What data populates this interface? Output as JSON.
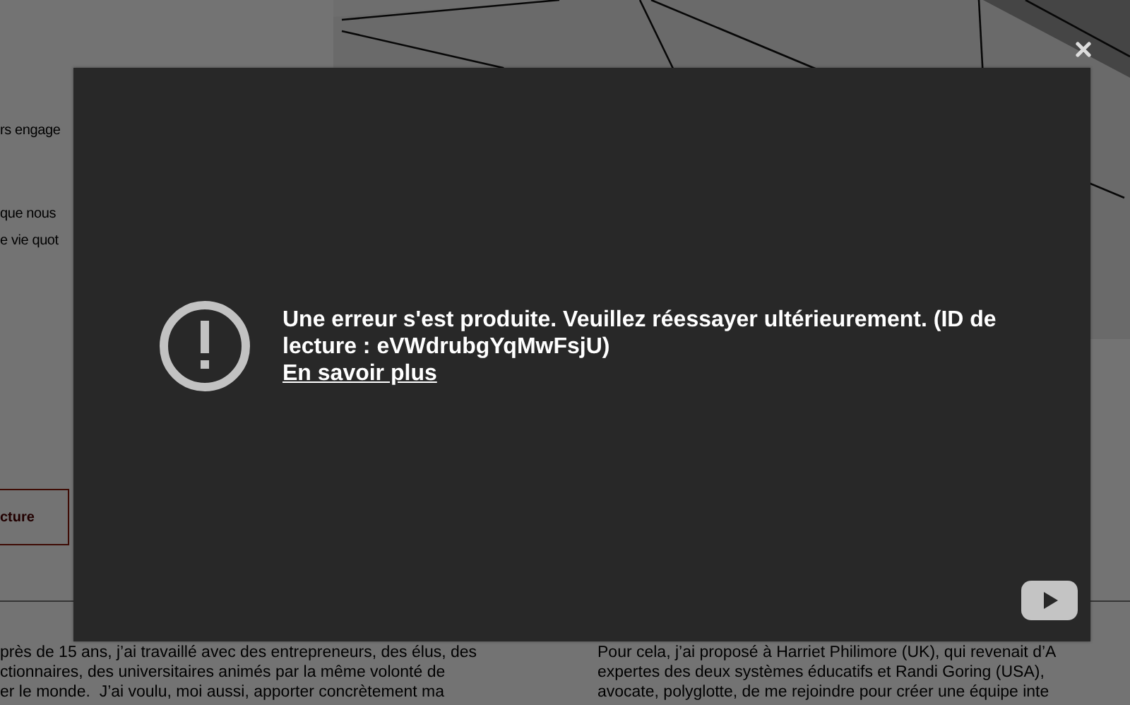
{
  "page": {
    "left_fragments": [
      "rs engage",
      "que nous",
      "e vie quot"
    ],
    "button": "cture",
    "paragraph_left": "près de 15 ans, j’ai travaillé avec des entrepreneurs, des élus, des\nctionnaires, des universitaires animés par la même volonté de\ner le monde.  J’ai voulu, moi aussi, apporter concrètement ma",
    "paragraph_right": "Pour cela, j’ai proposé à Harriet Philimore (UK), qui revenait d’A\nexpertes des deux systèmes éducatifs et Randi Goring (USA),\navocate, polyglotte, de me rejoindre pour créer une équipe inte"
  },
  "player": {
    "error_message": "Une erreur s'est produite. Veuillez réessayer ultérieurement. (ID de lecture : eVWdrubgYqMwFsjU)",
    "learn_more": "En savoir plus"
  }
}
